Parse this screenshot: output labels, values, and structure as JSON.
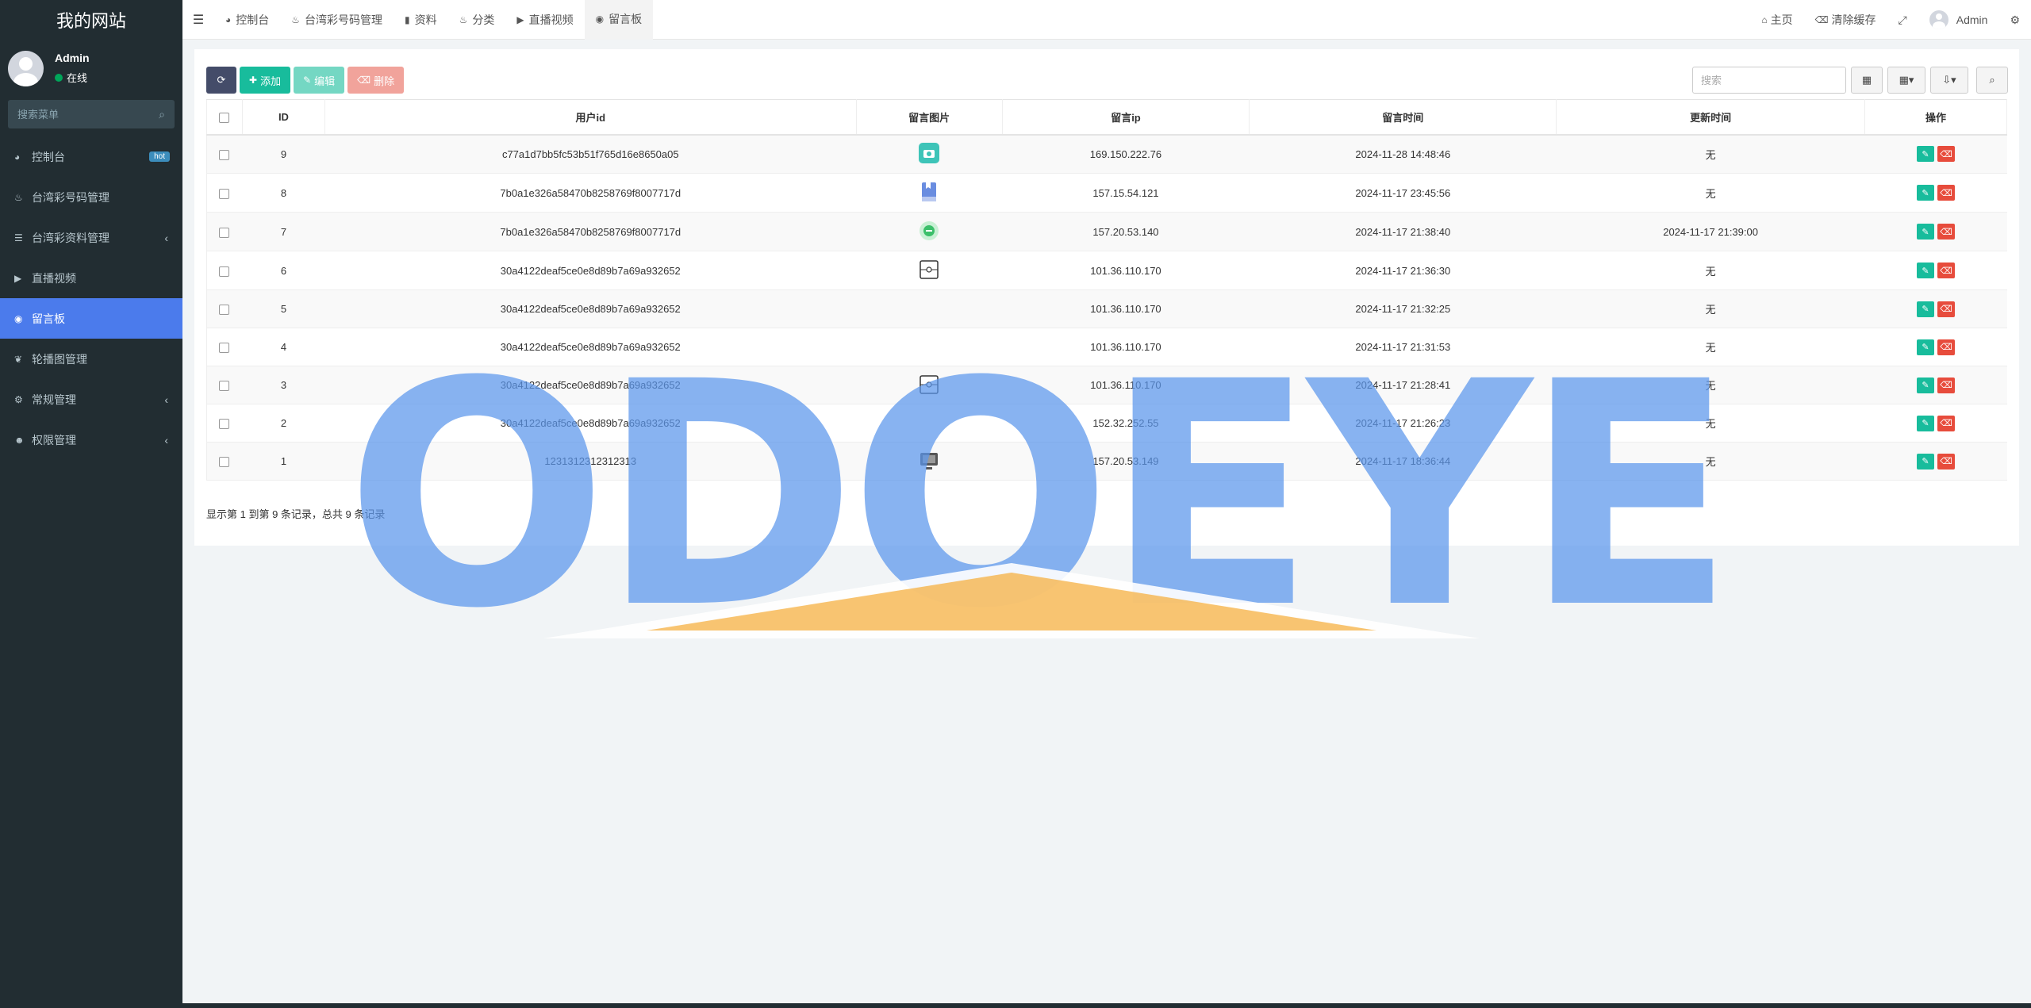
{
  "sidebar": {
    "brand": "我的网站",
    "user": {
      "name": "Admin",
      "status": "在线"
    },
    "search_placeholder": "搜索菜单",
    "items": [
      {
        "label": "控制台",
        "badge": "hot"
      },
      {
        "label": "台湾彩号码管理"
      },
      {
        "label": "台湾彩资料管理"
      },
      {
        "label": "直播视频"
      },
      {
        "label": "留言板"
      },
      {
        "label": "轮播图管理"
      },
      {
        "label": "常规管理"
      },
      {
        "label": "权限管理"
      }
    ]
  },
  "navbar": {
    "tabs": [
      {
        "label": "控制台"
      },
      {
        "label": "台湾彩号码管理"
      },
      {
        "label": "资料"
      },
      {
        "label": "分类"
      },
      {
        "label": "直播视频"
      },
      {
        "label": "留言板"
      }
    ],
    "right": {
      "home": "主页",
      "clear_cache": "清除缓存",
      "user": "Admin"
    }
  },
  "toolbar": {
    "add": "添加",
    "edit": "编辑",
    "delete": "删除",
    "search_placeholder": "搜索"
  },
  "table": {
    "headers": [
      "ID",
      "用户id",
      "留言图片",
      "留言ip",
      "留言时间",
      "更新时间",
      "操作"
    ],
    "rows": [
      {
        "id": "9",
        "user_id": "c77a1d7bb5fc53b51f765d16e8650a05",
        "ip": "169.150.222.76",
        "time": "2024-11-28 14:48:46",
        "updated": "无",
        "image": "camera-thumb"
      },
      {
        "id": "8",
        "user_id": "7b0a1e326a58470b8258769f8007717d",
        "ip": "157.15.54.121",
        "time": "2024-11-17 23:45:56",
        "updated": "无",
        "image": "bookmark-thumb"
      },
      {
        "id": "7",
        "user_id": "7b0a1e326a58470b8258769f8007717d",
        "ip": "157.20.53.140",
        "time": "2024-11-17 21:38:40",
        "updated": "2024-11-17 21:39:00",
        "image": "chat-thumb"
      },
      {
        "id": "6",
        "user_id": "30a4122deaf5ce0e8d89b7a69a932652",
        "ip": "101.36.110.170",
        "time": "2024-11-17 21:36:30",
        "updated": "无",
        "image": "frame-thumb"
      },
      {
        "id": "5",
        "user_id": "30a4122deaf5ce0e8d89b7a69a932652",
        "ip": "101.36.110.170",
        "time": "2024-11-17 21:32:25",
        "updated": "无",
        "image": ""
      },
      {
        "id": "4",
        "user_id": "30a4122deaf5ce0e8d89b7a69a932652",
        "ip": "101.36.110.170",
        "time": "2024-11-17 21:31:53",
        "updated": "无",
        "image": ""
      },
      {
        "id": "3",
        "user_id": "30a4122deaf5ce0e8d89b7a69a932652",
        "ip": "101.36.110.170",
        "time": "2024-11-17 21:28:41",
        "updated": "无",
        "image": "frame-thumb"
      },
      {
        "id": "2",
        "user_id": "30a4122deaf5ce0e8d89b7a69a932652",
        "ip": "152.32.252.55",
        "time": "2024-11-17 21:26:23",
        "updated": "无",
        "image": ""
      },
      {
        "id": "1",
        "user_id": "1231312312312313",
        "ip": "157.20.53.149",
        "time": "2024-11-17 18:36:44",
        "updated": "无",
        "image": "monitor-thumb"
      }
    ]
  },
  "pager": {
    "summary": "显示第 1 到第 9 条记录，总共 9 条记录"
  },
  "watermark": {
    "text": "ODOEYE"
  },
  "colors": {
    "sidebar_bg": "#222d32",
    "active": "#4b7bec",
    "success": "#18bc9c",
    "danger": "#e74c3c"
  }
}
